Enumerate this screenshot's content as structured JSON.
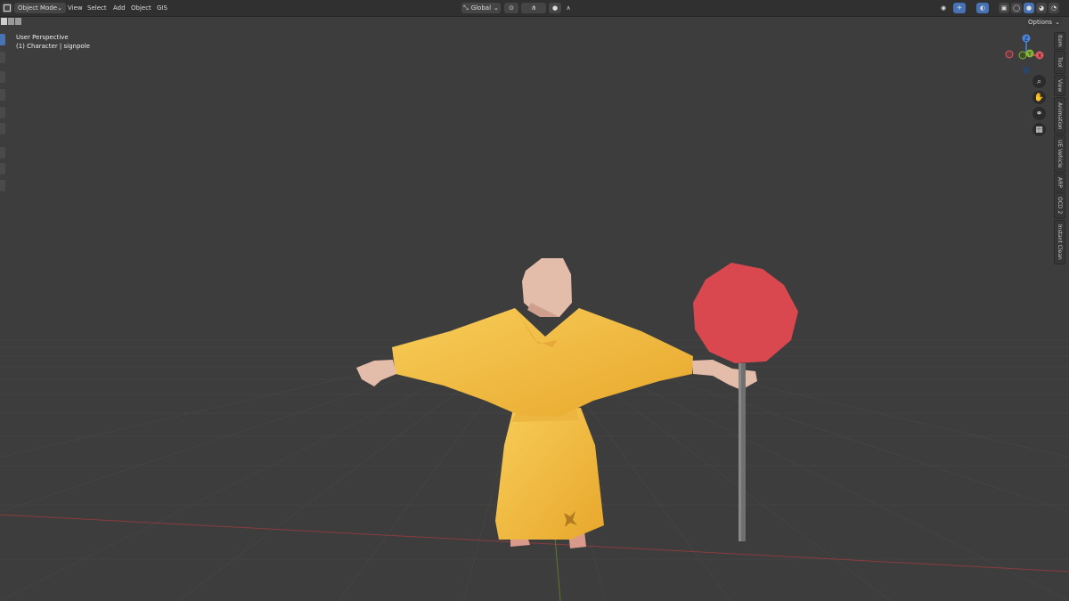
{
  "header": {
    "mode_label": "Object Mode",
    "menus": [
      "View",
      "Select",
      "Add",
      "Object",
      "GIS"
    ],
    "transform_orientation": "Global",
    "options_label": "Options"
  },
  "viewport": {
    "perspective_label": "User Perspective",
    "object_label": "(1) Character | signpole"
  },
  "gizmo": {
    "z_label": "Z",
    "x_label": "X",
    "y_label": "Y"
  },
  "sidebar_tabs": [
    "Item",
    "Tool",
    "View",
    "Animation",
    "UE Vehicle",
    "ARP",
    "OCD 2",
    "Instant Clean"
  ],
  "colors": {
    "background": "#3d3d3d",
    "header": "#303030",
    "accent": "#4772b3",
    "robe": "#f0b83a",
    "skin": "#e4bcaa",
    "sign": "#d9484f",
    "pole": "#707070",
    "x_axis": "#e0575f",
    "y_axis": "#82b634",
    "z_axis": "#4b87df"
  },
  "icons": {
    "mode": "object-mode-icon",
    "orientation": "transform-orientation-icon",
    "snap": "snap-icon",
    "overlay": "overlay-icon",
    "shading": "shading-solid-icon",
    "zoom": "zoom-icon",
    "pan": "hand-icon",
    "camera": "camera-icon",
    "grid": "grid-icon"
  }
}
